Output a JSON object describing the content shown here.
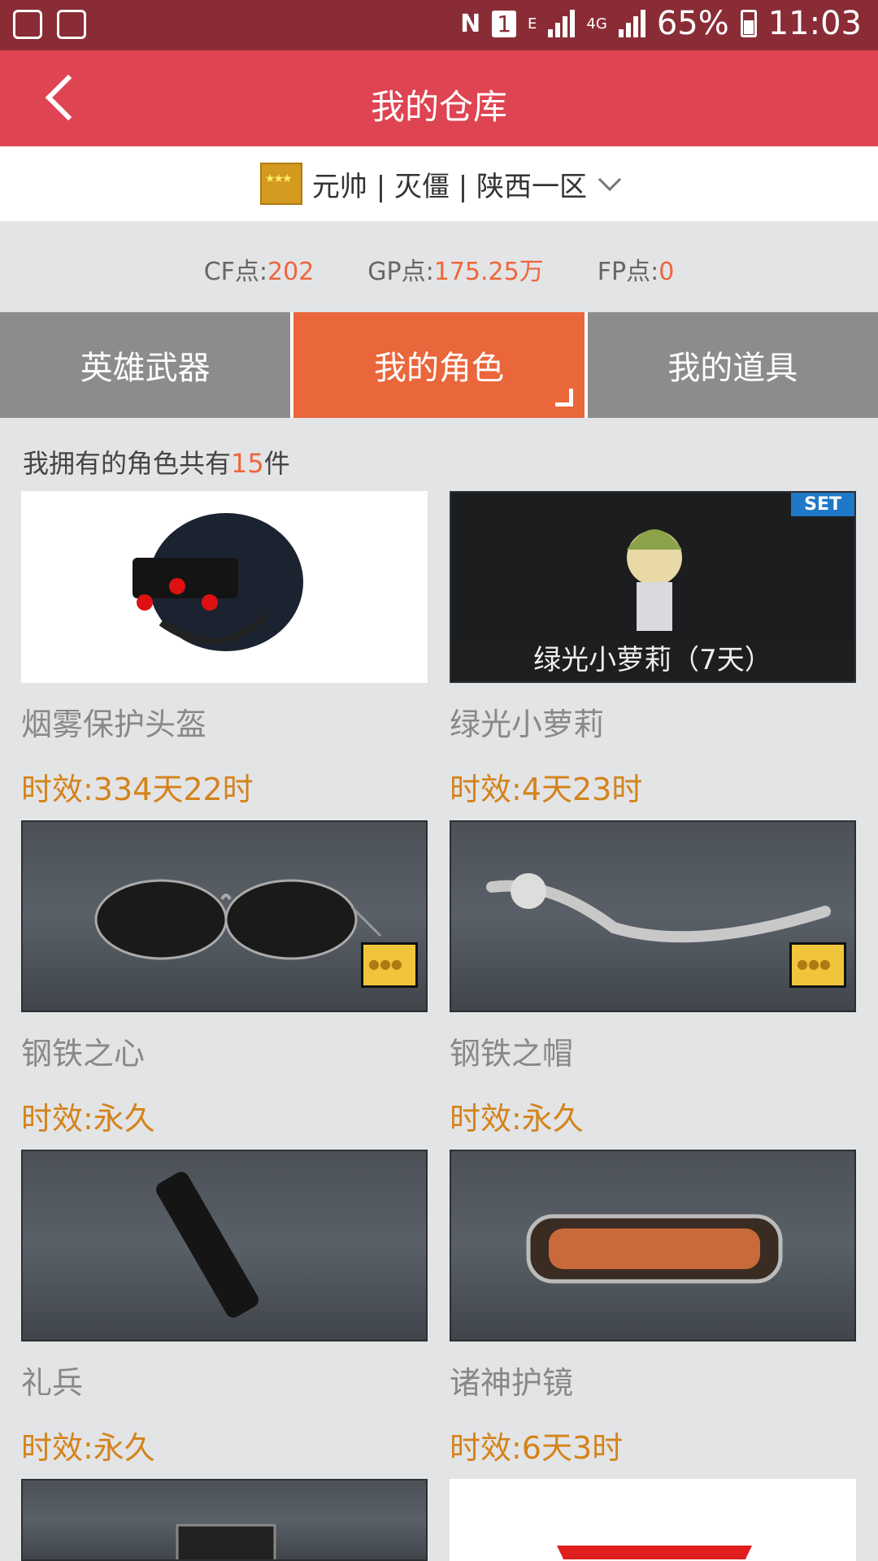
{
  "status_bar": {
    "battery": "65%",
    "time": "11:03",
    "network": "4G",
    "edge": "E",
    "sim": "1"
  },
  "header": {
    "title": "我的仓库"
  },
  "account": {
    "label": "元帅 | 灭僵 | 陕西一区"
  },
  "points": {
    "cf_label": "CF点:",
    "cf_value": "202",
    "gp_label": "GP点:",
    "gp_value": "175.25万",
    "fp_label": "FP点:",
    "fp_value": "0"
  },
  "tabs": [
    {
      "label": "英雄武器"
    },
    {
      "label": "我的角色"
    },
    {
      "label": "我的道具"
    }
  ],
  "summary": {
    "prefix": "我拥有的角色共有",
    "count": "15",
    "suffix": "件"
  },
  "items": [
    {
      "name": "烟雾保护头盔",
      "duration": "时效:334天22时"
    },
    {
      "name": "绿光小萝莉",
      "duration": "时效:4天23时",
      "tag": "SET",
      "caption": "绿光小萝莉（7天）"
    },
    {
      "name": "钢铁之心",
      "duration": "时效:永久"
    },
    {
      "name": "钢铁之帽",
      "duration": "时效:永久"
    },
    {
      "name": "礼兵",
      "duration": "时效:永久"
    },
    {
      "name": "诸神护镜",
      "duration": "时效:6天3时"
    }
  ],
  "colors": {
    "status_bar": "#8a2c36",
    "header": "#df4452",
    "tab_active": "#ea663b",
    "tab_inactive": "#8c8c8c",
    "accent": "#f0653a",
    "duration": "#d4831a"
  }
}
